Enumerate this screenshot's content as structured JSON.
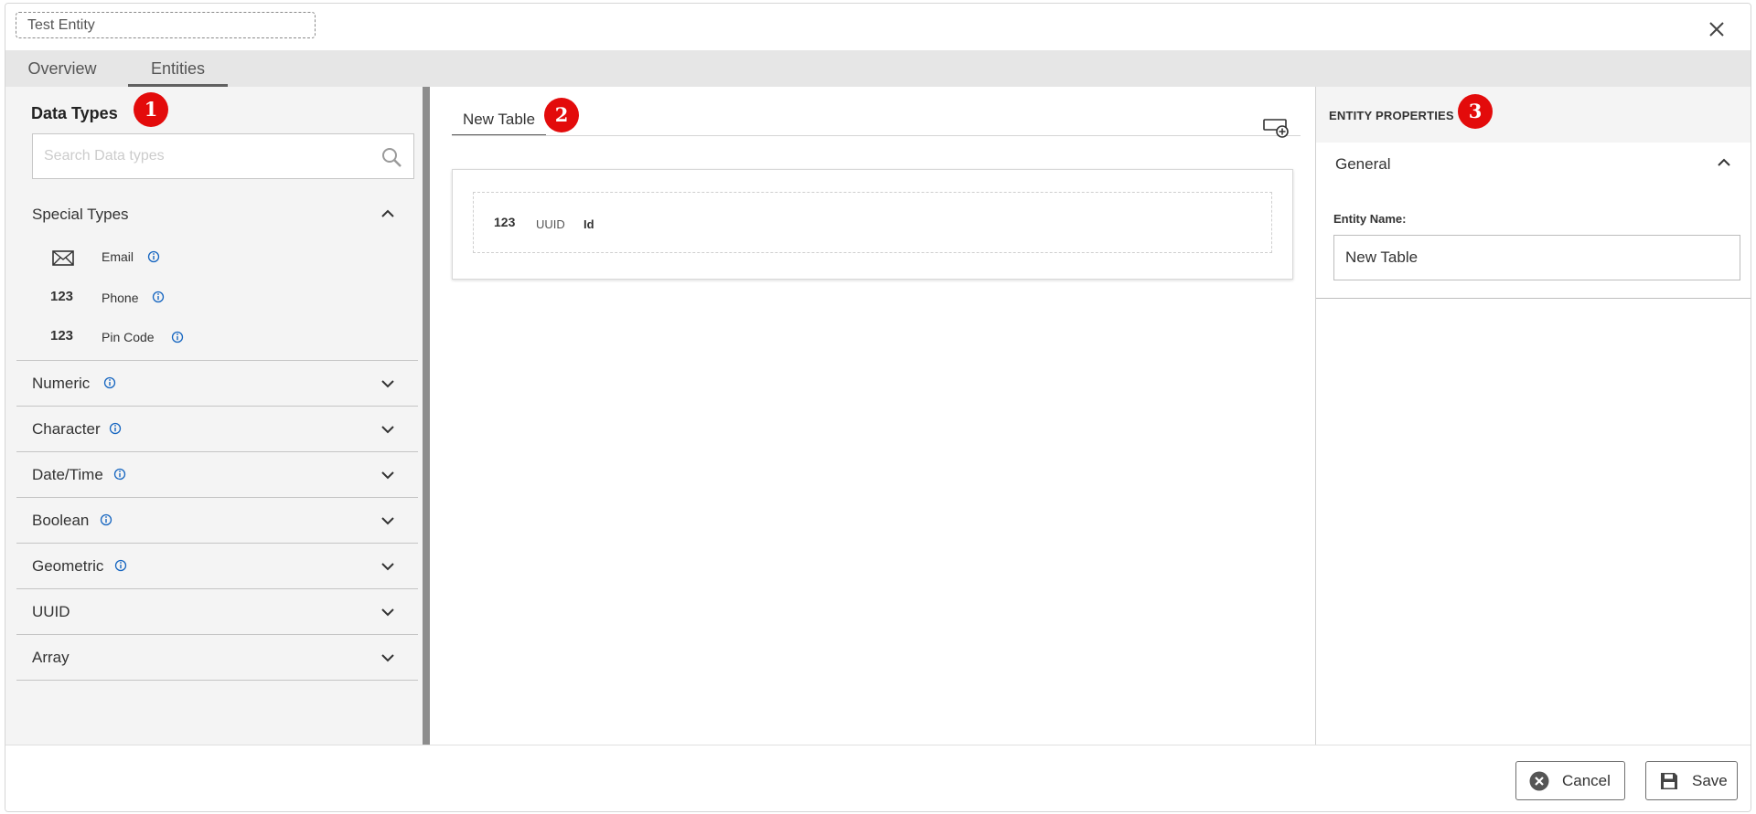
{
  "title_field": "Test Entity",
  "tabs": [
    {
      "label": "Overview"
    },
    {
      "label": "Entities"
    }
  ],
  "left_panel": {
    "title": "Data Types",
    "badge": "1",
    "search_placeholder": "Search Data types",
    "special_types": {
      "label": "Special Types",
      "items": [
        {
          "label": "Email",
          "icon": "envelope-icon"
        },
        {
          "label": "Phone",
          "icon_text": "123"
        },
        {
          "label": "Pin Code",
          "icon_text": "123"
        }
      ]
    },
    "categories": [
      {
        "label": "Numeric",
        "info": true
      },
      {
        "label": "Character",
        "info": true
      },
      {
        "label": "Date/Time",
        "info": true
      },
      {
        "label": "Boolean",
        "info": true
      },
      {
        "label": "Geometric",
        "info": true
      },
      {
        "label": "UUID",
        "info": false
      },
      {
        "label": "Array",
        "info": false
      }
    ]
  },
  "center_panel": {
    "tab_label": "New Table",
    "badge": "2",
    "entity_row": {
      "icon_text": "123",
      "type": "UUID",
      "field": "Id"
    }
  },
  "right_panel": {
    "title": "ENTITY PROPERTIES",
    "badge": "3",
    "section_label": "General",
    "entity_name_label": "Entity Name:",
    "entity_name_value": "New Table"
  },
  "footer": {
    "cancel_label": "Cancel",
    "save_label": "Save"
  },
  "colors": {
    "badge": "#e30b0b",
    "info_icon": "#1565c0",
    "panel_bg": "#f4f4f4",
    "tabbar_bg": "#e6e6e6"
  }
}
